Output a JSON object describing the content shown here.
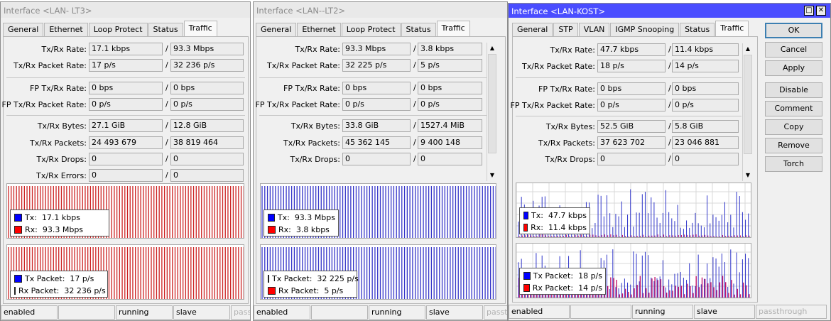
{
  "colors": {
    "tx": "#0000ff",
    "rx": "#ff0000",
    "active_title": "#4a4dff"
  },
  "windows": [
    {
      "title": "Interface <LAN- LT3>",
      "tabs": [
        "General",
        "Ethernet",
        "Loop Protect",
        "Status",
        "Traffic"
      ],
      "selected_tab": "Traffic",
      "fields": [
        {
          "label": "Tx/Rx Rate:",
          "tx": "17.1 kbps",
          "rx": "93.3 Mbps"
        },
        {
          "label": "Tx/Rx Packet Rate:",
          "tx": "17 p/s",
          "rx": "32 236 p/s"
        },
        {
          "label": "FP Tx/Rx Rate:",
          "tx": "0 bps",
          "rx": "0 bps"
        },
        {
          "label": "FP Tx/Rx Packet Rate:",
          "tx": "0 p/s",
          "rx": "0 p/s"
        },
        {
          "label": "Tx/Rx Bytes:",
          "tx": "27.1 GiB",
          "rx": "12.8 GiB"
        },
        {
          "label": "Tx/Rx Packets:",
          "tx": "24 493 679",
          "rx": "38 819 464"
        },
        {
          "label": "Tx/Rx Drops:",
          "tx": "0",
          "rx": "0"
        },
        {
          "label": "Tx/Rx Errors:",
          "tx": "0",
          "rx": "0"
        }
      ],
      "graph1": {
        "tx_label": "Tx:",
        "tx_value": "17.1 kbps",
        "rx_label": "Rx:",
        "rx_value": "93.3 Mbps"
      },
      "graph2": {
        "tx_label": "Tx Packet:",
        "tx_value": "17 p/s",
        "rx_label": "Rx Packet:",
        "rx_value": "32 236 p/s"
      },
      "status": [
        "enabled",
        "",
        "running",
        "slave",
        "passthrough"
      ]
    },
    {
      "title": "Interface <LAN--LT2>",
      "tabs": [
        "General",
        "Ethernet",
        "Loop Protect",
        "Status",
        "Traffic"
      ],
      "selected_tab": "Traffic",
      "fields": [
        {
          "label": "Tx/Rx Rate:",
          "tx": "93.3 Mbps",
          "rx": "3.8 kbps"
        },
        {
          "label": "Tx/Rx Packet Rate:",
          "tx": "32 225 p/s",
          "rx": "5 p/s"
        },
        {
          "label": "FP Tx/Rx Rate:",
          "tx": "0 bps",
          "rx": "0 bps"
        },
        {
          "label": "FP Tx/Rx Packet Rate:",
          "tx": "0 p/s",
          "rx": "0 p/s"
        },
        {
          "label": "Tx/Rx Bytes:",
          "tx": "33.8 GiB",
          "rx": "1527.4 MiB"
        },
        {
          "label": "Tx/Rx Packets:",
          "tx": "45 362 145",
          "rx": "9 400 148"
        },
        {
          "label": "Tx/Rx Drops:",
          "tx": "0",
          "rx": "0"
        }
      ],
      "graph1": {
        "tx_label": "Tx:",
        "tx_value": "93.3 Mbps",
        "rx_label": "Rx:",
        "rx_value": "3.8 kbps"
      },
      "graph2": {
        "tx_label": "Tx Packet:",
        "tx_value": "32 225 p/s",
        "rx_label": "Rx Packet:",
        "rx_value": "5 p/s"
      },
      "status": [
        "enabled",
        "",
        "running",
        "slave",
        "passthrough"
      ]
    },
    {
      "title": "Interface <LAN-KOST>",
      "tabs": [
        "General",
        "STP",
        "VLAN",
        "IGMP Snooping",
        "Status",
        "Traffic"
      ],
      "selected_tab": "Traffic",
      "fields": [
        {
          "label": "Tx/Rx Rate:",
          "tx": "47.7 kbps",
          "rx": "11.4 kbps"
        },
        {
          "label": "Tx/Rx Packet Rate:",
          "tx": "18 p/s",
          "rx": "14 p/s"
        },
        {
          "label": "FP Tx/Rx Rate:",
          "tx": "0 bps",
          "rx": "0 bps"
        },
        {
          "label": "FP Tx/Rx Packet Rate:",
          "tx": "0 p/s",
          "rx": "0 p/s"
        },
        {
          "label": "Tx/Rx Bytes:",
          "tx": "52.5 GiB",
          "rx": "5.8 GiB"
        },
        {
          "label": "Tx/Rx Packets:",
          "tx": "37 623 702",
          "rx": "23 046 881"
        },
        {
          "label": "Tx/Rx Drops:",
          "tx": "0",
          "rx": "0"
        }
      ],
      "graph1": {
        "tx_label": "Tx:",
        "tx_value": "47.7 kbps",
        "rx_label": "Rx:",
        "rx_value": "11.4 kbps"
      },
      "graph2": {
        "tx_label": "Tx Packet:",
        "tx_value": "18 p/s",
        "rx_label": "Rx Packet:",
        "rx_value": "14 p/s"
      },
      "status": [
        "enabled",
        "",
        "running",
        "slave",
        "passthrough"
      ],
      "buttons": [
        "OK",
        "Cancel",
        "Apply",
        "Disable",
        "Comment",
        "Copy",
        "Remove",
        "Torch"
      ]
    }
  ]
}
